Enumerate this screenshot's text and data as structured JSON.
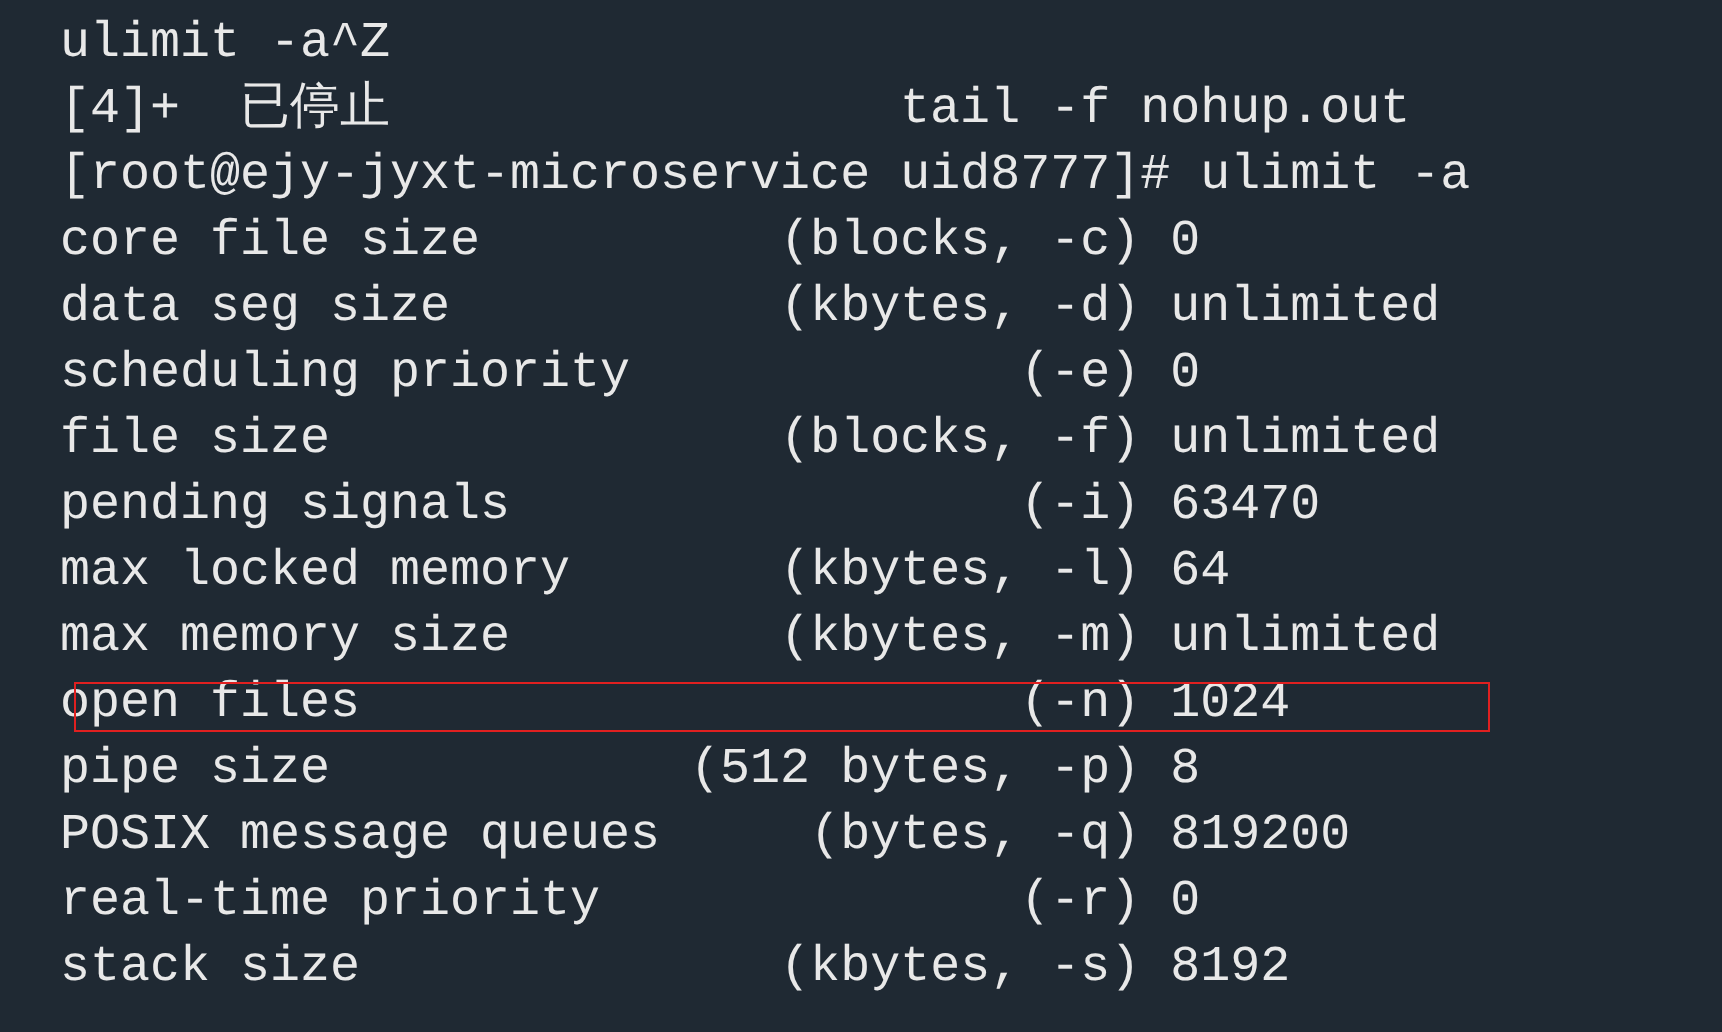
{
  "terminal": {
    "lines": [
      {
        "text": "ulimit -a^Z",
        "highlighted": false
      },
      {
        "text": "[4]+  已停止                 tail -f nohup.out",
        "highlighted": false
      },
      {
        "text": "[root@ejy-jyxt-microservice uid8777]# ulimit -a",
        "highlighted": false
      },
      {
        "text": "core file size          (blocks, -c) 0",
        "highlighted": false
      },
      {
        "text": "data seg size           (kbytes, -d) unlimited",
        "highlighted": false
      },
      {
        "text": "scheduling priority             (-e) 0",
        "highlighted": false
      },
      {
        "text": "file size               (blocks, -f) unlimited",
        "highlighted": false
      },
      {
        "text": "pending signals                 (-i) 63470",
        "highlighted": false
      },
      {
        "text": "max locked memory       (kbytes, -l) 64",
        "highlighted": false
      },
      {
        "text": "max memory size         (kbytes, -m) unlimited",
        "highlighted": false
      },
      {
        "text": "open files                      (-n) 1024",
        "highlighted": true
      },
      {
        "text": "pipe size            (512 bytes, -p) 8",
        "highlighted": false
      },
      {
        "text": "POSIX message queues     (bytes, -q) 819200",
        "highlighted": false
      },
      {
        "text": "real-time priority              (-r) 0",
        "highlighted": false
      },
      {
        "text": "stack size              (kbytes, -s) 8192",
        "highlighted": false
      }
    ]
  }
}
